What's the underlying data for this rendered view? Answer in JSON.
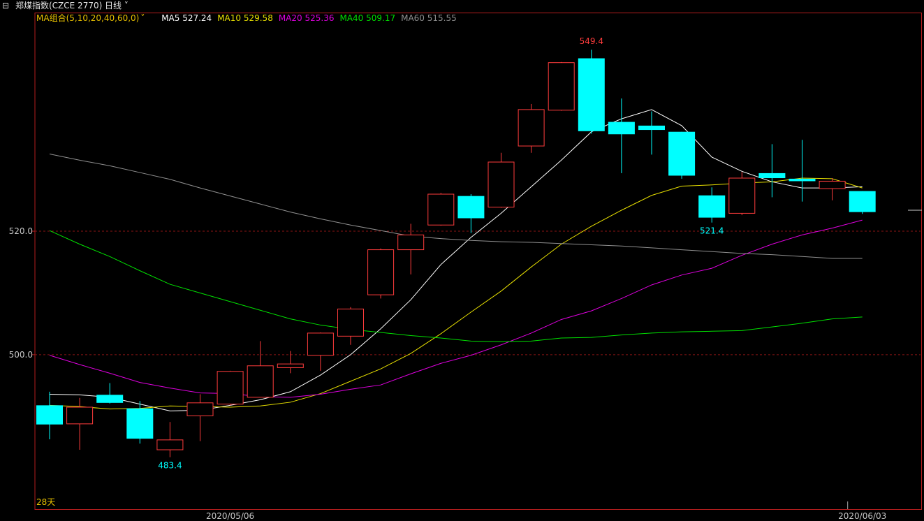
{
  "header": {
    "symbol_title": "郑煤指数(CZCE 2770)",
    "period": "日线"
  },
  "ma_legend": {
    "group_label": "MA组合(5,10,20,40,60,0)",
    "items": [
      {
        "label": "MA5",
        "value": "527.24",
        "color": "#ffffff"
      },
      {
        "label": "MA10",
        "value": "529.58",
        "color": "#e8e000"
      },
      {
        "label": "MA20",
        "value": "525.36",
        "color": "#e000e0"
      },
      {
        "label": "MA40",
        "value": "509.17",
        "color": "#00e000"
      },
      {
        "label": "MA60",
        "value": "515.55",
        "color": "#909090"
      }
    ]
  },
  "colors": {
    "up": "#ff3c3c",
    "down": "#00ffff",
    "frame": "#b41e1e",
    "grid": "#8a1414"
  },
  "chart_data": {
    "type": "candlestick",
    "ylim": [
      475.1,
      553.6
    ],
    "y_ticks": [
      "520.0",
      "500.0"
    ],
    "y_tick_values": [
      520,
      500
    ],
    "x_labels": [
      {
        "index": 6,
        "text": "2020/05/06"
      },
      {
        "index": 27,
        "text": "2020/06/03"
      }
    ],
    "days_label": "28天",
    "max_annotation": {
      "index": 18,
      "text": "549.4"
    },
    "min_annotation": {
      "index": 4,
      "text": "483.4"
    },
    "low_annotation": {
      "index": 22,
      "text": "521.4"
    },
    "last_price": 523.4,
    "candles": [
      {
        "o": 491.8,
        "h": 494.0,
        "l": 486.3,
        "c": 488.7
      },
      {
        "o": 488.8,
        "h": 493.0,
        "l": 484.6,
        "c": 491.5
      },
      {
        "o": 493.5,
        "h": 495.4,
        "l": 492.1,
        "c": 492.2
      },
      {
        "o": 491.3,
        "h": 492.5,
        "l": 485.6,
        "c": 486.4
      },
      {
        "o": 484.6,
        "h": 489.1,
        "l": 483.4,
        "c": 486.2
      },
      {
        "o": 490.1,
        "h": 493.6,
        "l": 486.0,
        "c": 492.2
      },
      {
        "o": 492.0,
        "h": 497.4,
        "l": 491.8,
        "c": 497.3
      },
      {
        "o": 493.1,
        "h": 502.2,
        "l": 493.1,
        "c": 498.2
      },
      {
        "o": 497.9,
        "h": 500.6,
        "l": 497.0,
        "c": 498.5
      },
      {
        "o": 499.9,
        "h": 503.6,
        "l": 497.4,
        "c": 503.5
      },
      {
        "o": 503.0,
        "h": 507.7,
        "l": 501.6,
        "c": 507.4
      },
      {
        "o": 509.7,
        "h": 517.2,
        "l": 509.1,
        "c": 517.0
      },
      {
        "o": 517.0,
        "h": 521.2,
        "l": 513.0,
        "c": 519.4
      },
      {
        "o": 521.0,
        "h": 526.2,
        "l": 520.9,
        "c": 526.0
      },
      {
        "o": 525.7,
        "h": 526.0,
        "l": 519.7,
        "c": 522.1
      },
      {
        "o": 523.9,
        "h": 532.7,
        "l": 523.8,
        "c": 531.2
      },
      {
        "o": 533.8,
        "h": 540.6,
        "l": 532.7,
        "c": 539.7
      },
      {
        "o": 539.6,
        "h": 547.4,
        "l": 539.5,
        "c": 547.3
      },
      {
        "o": 548.0,
        "h": 549.4,
        "l": 535.8,
        "c": 536.2
      },
      {
        "o": 537.7,
        "h": 541.5,
        "l": 529.4,
        "c": 535.7
      },
      {
        "o": 537.1,
        "h": 539.4,
        "l": 532.4,
        "c": 536.4
      },
      {
        "o": 536.1,
        "h": 536.1,
        "l": 528.5,
        "c": 529.0
      },
      {
        "o": 525.8,
        "h": 527.1,
        "l": 521.4,
        "c": 522.2
      },
      {
        "o": 522.9,
        "h": 529.6,
        "l": 522.6,
        "c": 528.6
      },
      {
        "o": 529.4,
        "h": 534.1,
        "l": 525.5,
        "c": 528.6
      },
      {
        "o": 528.5,
        "h": 534.8,
        "l": 524.8,
        "c": 528.1
      },
      {
        "o": 526.9,
        "h": 528.6,
        "l": 525.0,
        "c": 528.1
      },
      {
        "o": 526.5,
        "h": 526.5,
        "l": 522.8,
        "c": 523.1
      }
    ],
    "series": [
      {
        "name": "MA5",
        "color": "#ffffff",
        "values": [
          493.6,
          493.5,
          493.1,
          492.0,
          490.9,
          491.0,
          491.8,
          492.7,
          494.0,
          496.7,
          500.0,
          504.2,
          508.9,
          514.6,
          519.0,
          522.9,
          527.2,
          531.5,
          536.1,
          538.2,
          539.7,
          537.1,
          532.0,
          529.7,
          528.0,
          527.0,
          527.0,
          527.2
        ]
      },
      {
        "name": "MA10",
        "color": "#e8e000",
        "values": [
          491.8,
          491.6,
          491.2,
          491.3,
          491.7,
          491.6,
          491.5,
          491.7,
          492.3,
          493.7,
          495.7,
          497.7,
          500.2,
          503.4,
          506.9,
          510.3,
          514.2,
          517.9,
          520.8,
          523.4,
          525.8,
          527.3,
          527.5,
          527.8,
          528.0,
          528.6,
          528.5,
          527.0
        ]
      },
      {
        "name": "MA20",
        "color": "#e000e0",
        "values": [
          499.9,
          498.4,
          497.0,
          495.5,
          494.6,
          493.8,
          493.7,
          493.2,
          493.1,
          493.6,
          494.4,
          495.1,
          496.9,
          498.6,
          499.9,
          501.6,
          503.5,
          505.7,
          507.1,
          509.1,
          511.3,
          512.9,
          514.0,
          516.1,
          517.9,
          519.4,
          520.5,
          521.8
        ]
      },
      {
        "name": "MA40",
        "color": "#00e000",
        "values": [
          520.1,
          517.9,
          515.9,
          513.6,
          511.4,
          510.0,
          508.6,
          507.2,
          505.8,
          504.8,
          504.1,
          503.6,
          503.1,
          502.7,
          502.2,
          502.1,
          502.2,
          502.7,
          502.8,
          503.2,
          503.5,
          503.7,
          503.8,
          503.9,
          504.5,
          505.1,
          505.8,
          506.1
        ]
      },
      {
        "name": "MA60",
        "color": "#909090",
        "values": [
          532.5,
          531.5,
          530.6,
          529.5,
          528.4,
          527.0,
          525.7,
          524.4,
          523.1,
          522.0,
          521.0,
          520.1,
          519.2,
          518.8,
          518.5,
          518.3,
          518.2,
          518.0,
          517.8,
          517.6,
          517.3,
          517.0,
          516.7,
          516.4,
          516.2,
          515.9,
          515.6,
          515.6
        ]
      }
    ]
  }
}
